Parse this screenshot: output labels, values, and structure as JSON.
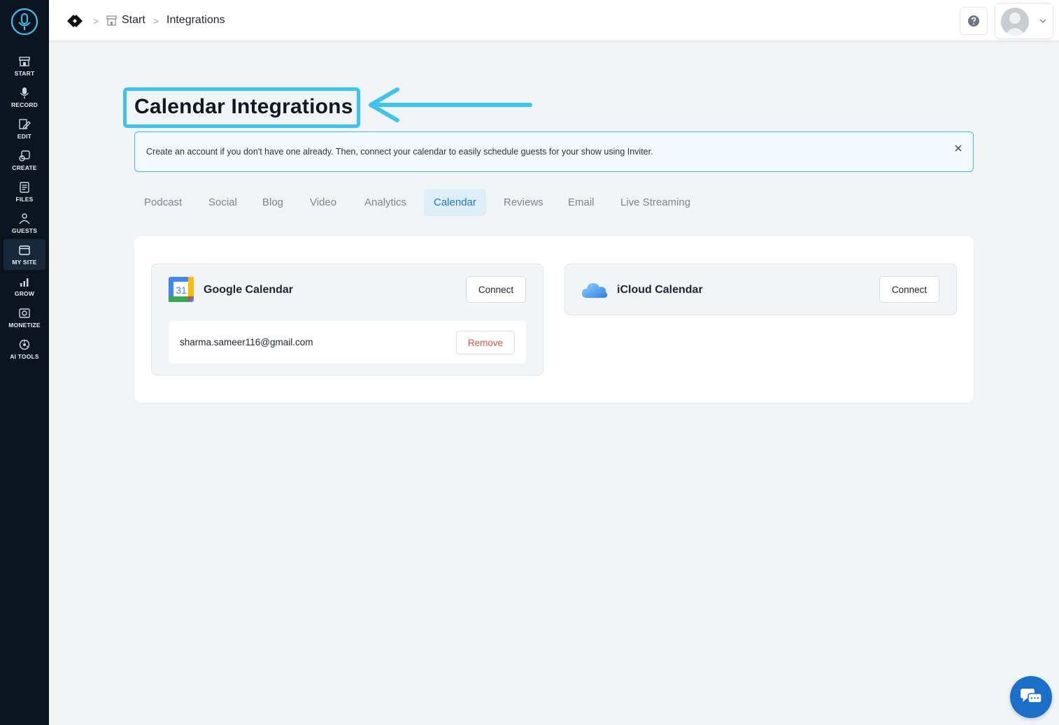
{
  "sidebar": {
    "items": [
      {
        "label": "START",
        "icon": "storefront-icon"
      },
      {
        "label": "RECORD",
        "icon": "microphone-icon"
      },
      {
        "label": "EDIT",
        "icon": "edit-icon"
      },
      {
        "label": "CREATE",
        "icon": "create-icon"
      },
      {
        "label": "FILES",
        "icon": "files-icon"
      },
      {
        "label": "GUESTS",
        "icon": "guests-icon"
      },
      {
        "label": "MY SITE",
        "icon": "browser-icon",
        "active": true
      },
      {
        "label": "GROW",
        "icon": "bar-chart-icon"
      },
      {
        "label": "MONETIZE",
        "icon": "monetize-icon"
      },
      {
        "label": "AI TOOLS",
        "icon": "ai-tools-icon"
      }
    ]
  },
  "breadcrumb": {
    "separator": ">",
    "items": [
      "Start",
      "Integrations"
    ]
  },
  "page": {
    "title": "Calendar Integrations"
  },
  "banner": {
    "text": "Create an account if you don't have one already. Then, connect your calendar to easily schedule guests for your show using Inviter.",
    "close": "×"
  },
  "tabs": [
    {
      "label": "Podcast"
    },
    {
      "label": "Social"
    },
    {
      "label": "Blog"
    },
    {
      "label": "Video"
    },
    {
      "label": "Analytics"
    },
    {
      "label": "Calendar",
      "active": true
    },
    {
      "label": "Reviews"
    },
    {
      "label": "Email"
    },
    {
      "label": "Live Streaming"
    }
  ],
  "integrations": {
    "google": {
      "name": "Google Calendar",
      "icon_text": "31",
      "connect_label": "Connect",
      "account_email": "sharma.sameer116@gmail.com",
      "remove_label": "Remove"
    },
    "icloud": {
      "name": "iCloud Calendar",
      "connect_label": "Connect"
    }
  },
  "colors": {
    "sidebar_bg": "#0b1520",
    "accent": "#3ec3f0",
    "active_tab_text": "#1e7cc0",
    "remove_text": "#e0524a",
    "chat_bg": "#1c6fc9"
  }
}
